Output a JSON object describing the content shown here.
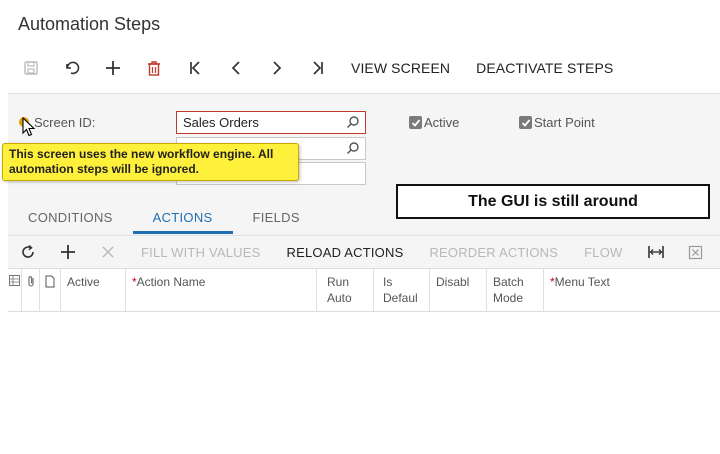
{
  "page": {
    "title": "Automation Steps"
  },
  "toolbar": {
    "save_icon": "save-icon",
    "undo_icon": "undo-icon",
    "add_icon": "plus-icon",
    "delete_icon": "trash-icon",
    "first_icon": "first-record-icon",
    "prev_icon": "previous-record-icon",
    "next_icon": "next-record-icon",
    "last_icon": "last-record-icon",
    "view_screen_label": "VIEW SCREEN",
    "deactivate_label": "DEACTIVATE STEPS"
  },
  "form": {
    "screen_id_label": "Screen ID:",
    "screen_id_value": "Sales Orders",
    "second_field_value": "",
    "third_field_value": "",
    "active_label": "Active",
    "active_checked": true,
    "start_point_label": "Start Point",
    "start_point_checked": true
  },
  "tooltip": {
    "text": "This screen uses the new workflow engine. All automation steps will be ignored."
  },
  "annotation": {
    "text": "The GUI is still around"
  },
  "tabs": [
    {
      "label": "CONDITIONS",
      "active": false
    },
    {
      "label": "ACTIONS",
      "active": true
    },
    {
      "label": "FIELDS",
      "active": false
    }
  ],
  "grid_toolbar": {
    "refresh_icon": "refresh-icon",
    "add_icon": "plus-icon",
    "delete_icon": "close-icon",
    "fill_label": "FILL WITH VALUES",
    "reload_label": "RELOAD ACTIONS",
    "reorder_label": "REORDER ACTIONS",
    "flow_label": "FLOW",
    "fit_icon": "fit-columns-icon",
    "excel_icon": "export-excel-icon"
  },
  "grid": {
    "columns": [
      {
        "label": "",
        "required": false
      },
      {
        "label": "",
        "required": false
      },
      {
        "label": "",
        "required": false
      },
      {
        "label": "Active",
        "required": false
      },
      {
        "label": "Action Name",
        "required": true
      },
      {
        "label": "Run Auto",
        "required": false
      },
      {
        "label": "Is Defaul",
        "required": false
      },
      {
        "label": "Disabl",
        "required": false
      },
      {
        "label": "Batch Mode",
        "required": false
      },
      {
        "label": "Menu Text",
        "required": true
      }
    ]
  }
}
